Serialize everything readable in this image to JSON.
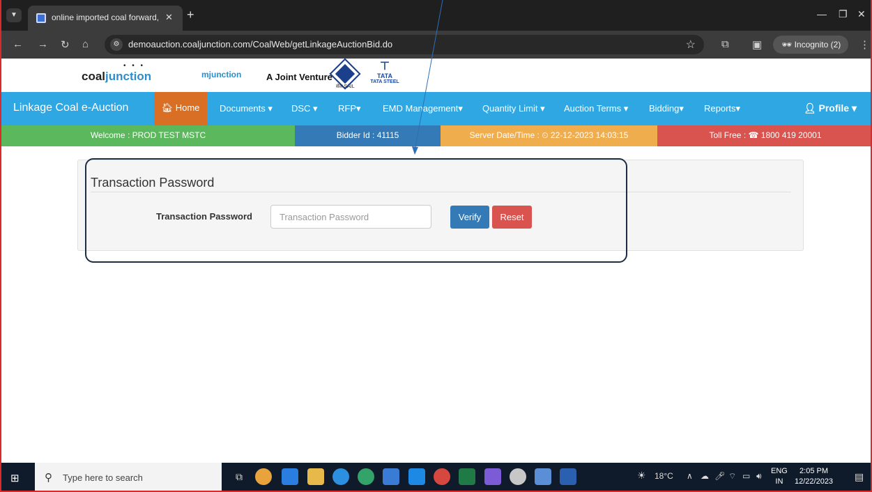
{
  "browser": {
    "tab_title": "online imported coal forward, s",
    "url": "demoauction.coaljunction.com/CoalWeb/getLinkageAuctionBid.do",
    "incognito_label": "Incognito (2)"
  },
  "header": {
    "logo_prefix": "coal",
    "logo_suffix": "junction",
    "mjunction": "mjunction",
    "joint_venture": "A Joint Venture of",
    "sail": "सेल SAIL",
    "tata_line1": "TATA",
    "tata_line2": "TATA STEEL"
  },
  "nav": {
    "brand": "Linkage Coal e-Auction",
    "home": "Home",
    "items": [
      "Documents ▾",
      "DSC ▾",
      "RFP▾",
      "EMD Management▾",
      "Quantity Limit ▾",
      "Auction Terms ▾",
      "Bidding▾",
      "Reports▾"
    ],
    "profile": "Profile ▾"
  },
  "infobar": {
    "welcome": "Welcome : PROD TEST MSTC",
    "bidder": "Bidder Id : 41115",
    "server_label": "Server Date/Time : ",
    "server_time": "22-12-2023 14:03:15",
    "toll_label": "Toll Free : ",
    "toll_number": "1800 419 20001",
    "colors": {
      "welcome": "#5cb85c",
      "bidder": "#337ab7",
      "server": "#f0ad4e",
      "toll": "#d9534f"
    }
  },
  "panel": {
    "title": "Transaction Password",
    "field_label": "Transaction Password",
    "input_value": "",
    "input_placeholder": "Transaction Password",
    "verify": "Verify",
    "reset": "Reset"
  },
  "taskbar": {
    "search_placeholder": "Type here to search",
    "weather": "18°C",
    "lang_line1": "ENG",
    "lang_line2": "IN",
    "time": "2:05 PM",
    "date": "12/22/2023"
  }
}
